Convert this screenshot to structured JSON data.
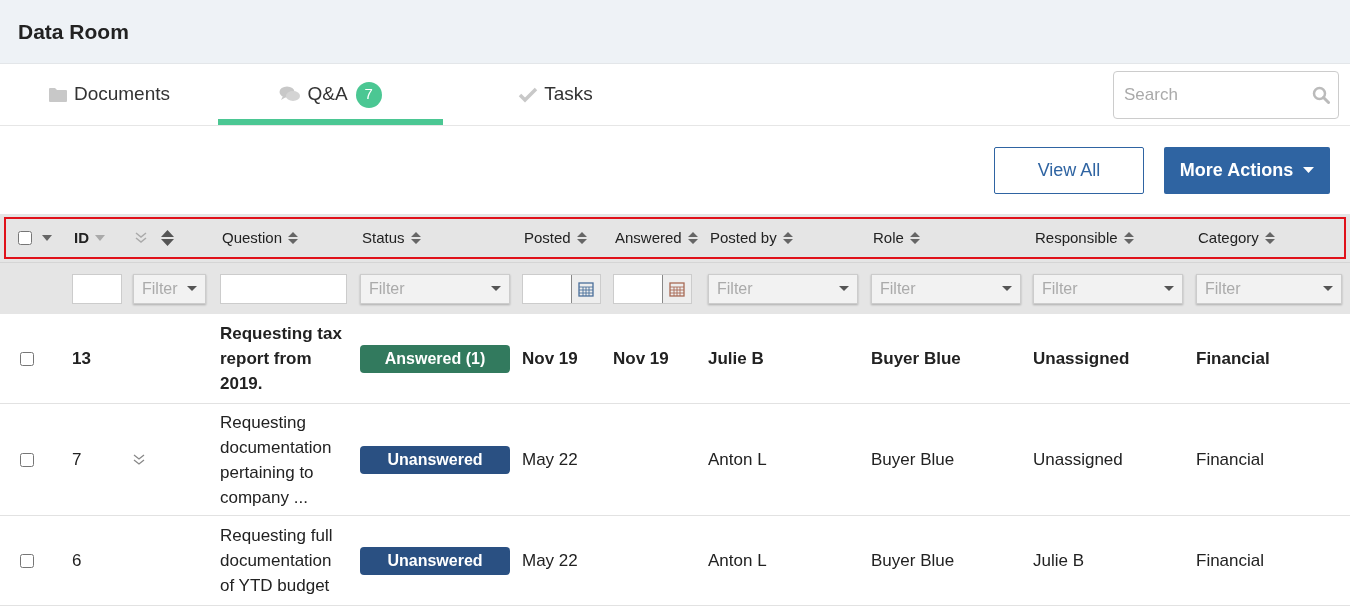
{
  "header": {
    "title": "Data Room"
  },
  "tabs": [
    {
      "label": "Documents",
      "selected": false
    },
    {
      "label": "Q&A",
      "badge": "7",
      "selected": true
    },
    {
      "label": "Tasks",
      "selected": false
    }
  ],
  "search": {
    "placeholder": "Search"
  },
  "actions": [
    {
      "label": "View All",
      "kind": "outline"
    },
    {
      "label": "More Actions",
      "kind": "primary"
    }
  ],
  "table": {
    "highlighted": true,
    "columns": [
      {
        "kind": "select-all"
      },
      {
        "label": "ID",
        "kind": "sort-down"
      },
      {
        "kind": "expand-sort"
      },
      {
        "label": "Question",
        "kind": "sort"
      },
      {
        "label": "Status",
        "kind": "sort"
      },
      {
        "label": "Posted",
        "kind": "sort"
      },
      {
        "label": "Answered",
        "kind": "sort"
      },
      {
        "label": "Posted by",
        "kind": "sort"
      },
      {
        "label": "Role",
        "kind": "sort"
      },
      {
        "label": "Responsible",
        "kind": "sort"
      },
      {
        "label": "Category",
        "kind": "sort"
      }
    ],
    "filters": [
      {
        "kind": "none"
      },
      {
        "kind": "text"
      },
      {
        "kind": "small-select",
        "placeholder": "Filter"
      },
      {
        "kind": "text"
      },
      {
        "kind": "select",
        "placeholder": "Filter"
      },
      {
        "kind": "date"
      },
      {
        "kind": "date"
      },
      {
        "kind": "select",
        "placeholder": "Filter"
      },
      {
        "kind": "select",
        "placeholder": "Filter"
      },
      {
        "kind": "select",
        "placeholder": "Filter"
      },
      {
        "kind": "select",
        "placeholder": "Filter"
      }
    ],
    "rows": [
      {
        "checked": false,
        "unread": true,
        "thread": false,
        "id": "13",
        "question": "Requesting tax report from 2019.",
        "status": "Answered (1)",
        "color": "#327a5e",
        "posted": "Nov 19",
        "answered": "Nov 19",
        "posted_by": "Julie B",
        "role": "Buyer Blue",
        "responsible": "Unassigned",
        "category": "Financial"
      },
      {
        "checked": false,
        "unread": false,
        "thread": true,
        "id": "7",
        "question": "Requesting documentation pertaining to company ...",
        "status": "Unanswered",
        "color": "#2a5082",
        "posted": "May 22",
        "posted_by": "Anton L",
        "role": "Buyer Blue",
        "responsible": "Unassigned",
        "category": "Financial"
      },
      {
        "checked": false,
        "unread": false,
        "thread": false,
        "id": "6",
        "question": "Requesting full documentation of YTD budget",
        "status": "Unanswered",
        "color": "#2a5082",
        "posted": "May 22",
        "posted_by": "Anton L",
        "role": "Buyer Blue",
        "responsible": "Julie B",
        "category": "Financial"
      }
    ]
  }
}
